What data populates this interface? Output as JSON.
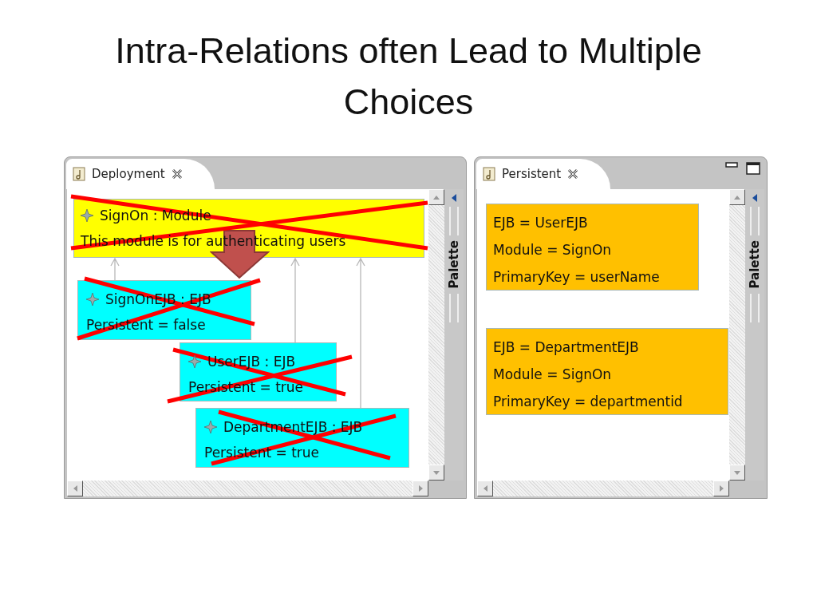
{
  "slide": {
    "title": "Intra-Relations often Lead to Multiple Choices"
  },
  "panels": [
    {
      "tab": {
        "label": "Deployment",
        "selected": true
      },
      "window_controls": false,
      "palette": "Palette",
      "items": [
        {
          "kind": "module",
          "title": "SignOn : Module",
          "detail": "This module is for authenticating users",
          "crossed_out": true
        },
        {
          "kind": "ejb",
          "title": "SignOnEJB : EJB",
          "detail": "Persistent = false",
          "crossed_out": true
        },
        {
          "kind": "ejb",
          "title": "UserEJB : EJB",
          "detail": "Persistent = true",
          "crossed_out": true
        },
        {
          "kind": "ejb",
          "title": "DepartmentEJB : EJB",
          "detail": "Persistent = true",
          "crossed_out": true
        }
      ]
    },
    {
      "tab": {
        "label": "Persistent",
        "selected": true
      },
      "window_controls": true,
      "palette": "Palette",
      "items": [
        {
          "kind": "binding",
          "lines": [
            "EJB = UserEJB",
            "Module = SignOn",
            "PrimaryKey = userName"
          ]
        },
        {
          "kind": "binding",
          "lines": [
            "EJB = DepartmentEJB",
            "Module = SignOn",
            "PrimaryKey = departmentid"
          ]
        }
      ]
    }
  ]
}
